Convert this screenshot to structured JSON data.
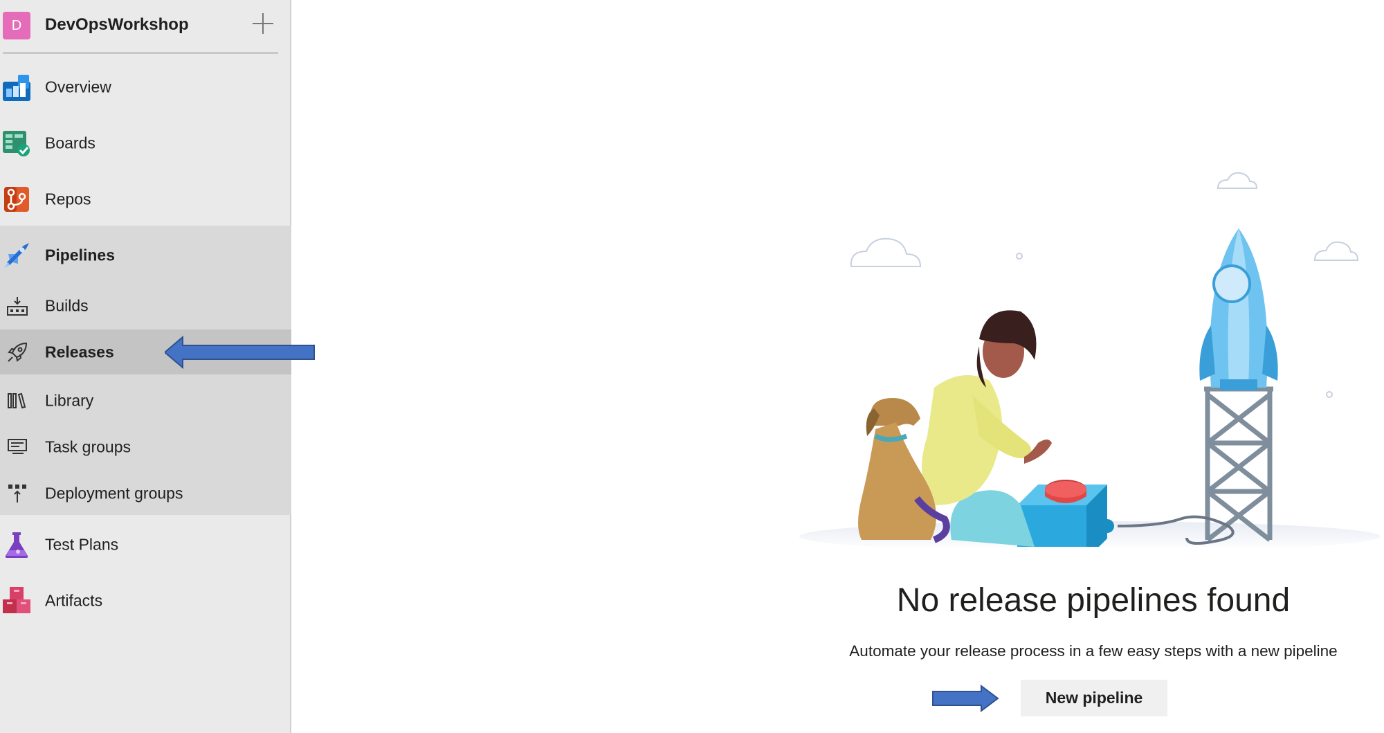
{
  "project": {
    "avatar_letter": "D",
    "name": "DevOpsWorkshop",
    "avatar_color": "#e46cb8"
  },
  "nav": {
    "overview": "Overview",
    "boards": "Boards",
    "repos": "Repos",
    "pipelines": "Pipelines",
    "builds": "Builds",
    "releases": "Releases",
    "library": "Library",
    "task_groups": "Task groups",
    "deployment_groups": "Deployment groups",
    "test_plans": "Test Plans",
    "artifacts": "Artifacts"
  },
  "nav_icons": {
    "overview": "overview-icon",
    "boards": "boards-icon",
    "repos": "repos-icon",
    "pipelines": "pipelines-icon",
    "builds": "builds-icon",
    "releases": "rocket-icon",
    "library": "library-icon",
    "task_groups": "task-groups-icon",
    "deployment_groups": "deployment-groups-icon",
    "test_plans": "test-plans-icon",
    "artifacts": "artifacts-icon"
  },
  "selected_item": "Releases",
  "empty_state": {
    "title": "No release pipelines found",
    "subtitle": "Automate your release process in a few easy steps with a new pipeline",
    "button_label": "New pipeline",
    "illustration": "person-dog-rocket-launch-illustration"
  },
  "colors": {
    "sidebar_bg": "#eaeaea",
    "group_bg": "#d9d9d9",
    "selected_bg": "#c4c4c4",
    "annotation_arrow": "#4472c4",
    "button_bg": "#f0f0f0"
  }
}
